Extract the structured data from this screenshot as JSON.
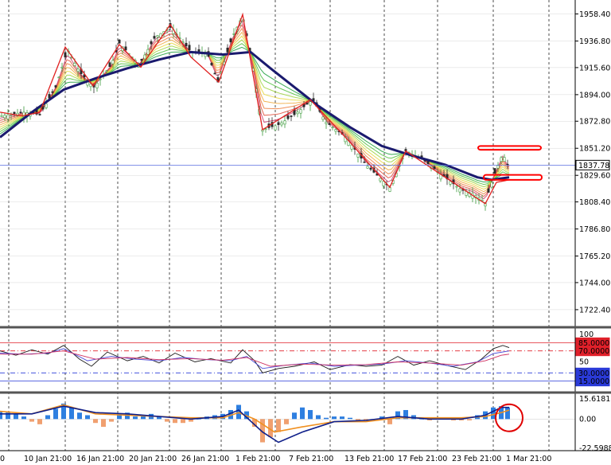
{
  "chart_data": [
    {
      "type": "candlestick",
      "title": "",
      "price_axis": {
        "ticks": [
          1958.4,
          1936.8,
          1915.6,
          1894.0,
          1872.8,
          1851.2,
          1829.6,
          1808.4,
          1786.8,
          1765.2,
          1744.0,
          1722.4
        ],
        "tick_labels": [
          "1958.40",
          "1936.80",
          "1915.60",
          "1894.00",
          "1872.80",
          "1851.20",
          "1829.60",
          "1808.40",
          "1786.80",
          "1765.20",
          "1744.00",
          "1722.40"
        ],
        "ylim": [
          1709,
          1967
        ]
      },
      "time_axis": {
        "labels": [
          "0",
          "10 Jan 21:00",
          "16 Jan 21:00",
          "20 Jan 21:00",
          "26 Jan 21:00",
          "1 Feb 21:00",
          "7 Feb 21:00",
          "13 Feb 21:00",
          "17 Feb 21:00",
          "23 Feb 21:00",
          "1 Mar 21:00"
        ]
      },
      "current_price": "1837.78",
      "current_price_value": 1837.78,
      "close_series": [
        {
          "t": 0,
          "v": 1877
        },
        {
          "t": 30,
          "v": 1880
        },
        {
          "t": 50,
          "v": 1878
        },
        {
          "t": 70,
          "v": 1900
        },
        {
          "t": 85,
          "v": 1930
        },
        {
          "t": 100,
          "v": 1912
        },
        {
          "t": 118,
          "v": 1900
        },
        {
          "t": 140,
          "v": 1918
        },
        {
          "t": 150,
          "v": 1935
        },
        {
          "t": 175,
          "v": 1918
        },
        {
          "t": 195,
          "v": 1940
        },
        {
          "t": 215,
          "v": 1948
        },
        {
          "t": 240,
          "v": 1928
        },
        {
          "t": 260,
          "v": 1928
        },
        {
          "t": 274,
          "v": 1904
        },
        {
          "t": 292,
          "v": 1940
        },
        {
          "t": 305,
          "v": 1957
        },
        {
          "t": 318,
          "v": 1915
        },
        {
          "t": 330,
          "v": 1866
        },
        {
          "t": 350,
          "v": 1870
        },
        {
          "t": 370,
          "v": 1878
        },
        {
          "t": 393,
          "v": 1890
        },
        {
          "t": 410,
          "v": 1872
        },
        {
          "t": 435,
          "v": 1860
        },
        {
          "t": 460,
          "v": 1838
        },
        {
          "t": 490,
          "v": 1820
        },
        {
          "t": 510,
          "v": 1849
        },
        {
          "t": 530,
          "v": 1843
        },
        {
          "t": 555,
          "v": 1830
        },
        {
          "t": 580,
          "v": 1818
        },
        {
          "t": 595,
          "v": 1815
        },
        {
          "t": 610,
          "v": 1808
        },
        {
          "t": 620,
          "v": 1828
        },
        {
          "t": 632,
          "v": 1847
        },
        {
          "t": 638,
          "v": 1838
        }
      ],
      "ma_bold": [
        {
          "t": 0,
          "v": 1860
        },
        {
          "t": 40,
          "v": 1880
        },
        {
          "t": 80,
          "v": 1898
        },
        {
          "t": 120,
          "v": 1907
        },
        {
          "t": 160,
          "v": 1915
        },
        {
          "t": 200,
          "v": 1922
        },
        {
          "t": 240,
          "v": 1928
        },
        {
          "t": 280,
          "v": 1926
        },
        {
          "t": 315,
          "v": 1928
        },
        {
          "t": 340,
          "v": 1915
        },
        {
          "t": 370,
          "v": 1900
        },
        {
          "t": 400,
          "v": 1885
        },
        {
          "t": 440,
          "v": 1868
        },
        {
          "t": 480,
          "v": 1853
        },
        {
          "t": 520,
          "v": 1845
        },
        {
          "t": 560,
          "v": 1838
        },
        {
          "t": 600,
          "v": 1828
        },
        {
          "t": 618,
          "v": 1826
        },
        {
          "t": 640,
          "v": 1828
        }
      ],
      "zigzag": [
        {
          "t": 0,
          "v": 1880
        },
        {
          "t": 28,
          "v": 1877
        },
        {
          "t": 50,
          "v": 1880
        },
        {
          "t": 82,
          "v": 1932
        },
        {
          "t": 117,
          "v": 1901
        },
        {
          "t": 150,
          "v": 1934
        },
        {
          "t": 177,
          "v": 1916
        },
        {
          "t": 214,
          "v": 1950
        },
        {
          "t": 240,
          "v": 1924
        },
        {
          "t": 275,
          "v": 1904
        },
        {
          "t": 305,
          "v": 1958
        },
        {
          "t": 330,
          "v": 1866
        },
        {
          "t": 390,
          "v": 1890
        },
        {
          "t": 440,
          "v": 1856
        },
        {
          "t": 490,
          "v": 1820
        },
        {
          "t": 510,
          "v": 1849
        },
        {
          "t": 555,
          "v": 1830
        },
        {
          "t": 610,
          "v": 1807
        },
        {
          "t": 624,
          "v": 1824
        },
        {
          "t": 640,
          "v": 1826
        }
      ],
      "annotations": [
        {
          "kind": "rect",
          "t0": 601,
          "t1": 680,
          "v0": 1850,
          "v1": 1853,
          "color": "#ff0000"
        },
        {
          "kind": "rect",
          "t0": 608,
          "t1": 681,
          "v0": 1826,
          "v1": 1830,
          "color": "#ff0000"
        }
      ],
      "colors": {
        "bull": "#3a9a3a",
        "bear": "#2b2b2b",
        "zigzag": "#e02020",
        "ma_bold": "#1a1a6e",
        "price_line": "#5a6ee0",
        "grid": "#000000"
      }
    },
    {
      "type": "line",
      "title": "",
      "y_ticks": [
        "100",
        "50"
      ],
      "levels": [
        {
          "label": "85.0000",
          "value": 85,
          "color": "#e0202a"
        },
        {
          "label": "70.0000",
          "value": 70,
          "color": "#e0202a"
        },
        {
          "label": "30.0000",
          "value": 30,
          "color": "#2a3ad8"
        },
        {
          "label": "15.0000",
          "value": 15,
          "color": "#2a3ad8"
        }
      ],
      "ylim": [
        0,
        100
      ],
      "series": [
        {
          "color": "#1b1b1b",
          "values": [
            [
              0,
              70
            ],
            [
              20,
              62
            ],
            [
              40,
              72
            ],
            [
              60,
              64
            ],
            [
              80,
              80
            ],
            [
              100,
              55
            ],
            [
              115,
              42
            ],
            [
              135,
              68
            ],
            [
              160,
              52
            ],
            [
              180,
              60
            ],
            [
              200,
              48
            ],
            [
              220,
              66
            ],
            [
              245,
              50
            ],
            [
              265,
              56
            ],
            [
              290,
              48
            ],
            [
              305,
              72
            ],
            [
              320,
              52
            ],
            [
              330,
              30
            ],
            [
              350,
              38
            ],
            [
              370,
              42
            ],
            [
              395,
              50
            ],
            [
              415,
              36
            ],
            [
              440,
              45
            ],
            [
              460,
              42
            ],
            [
              480,
              44
            ],
            [
              500,
              60
            ],
            [
              520,
              44
            ],
            [
              540,
              52
            ],
            [
              560,
              44
            ],
            [
              585,
              36
            ],
            [
              605,
              55
            ],
            [
              620,
              74
            ],
            [
              632,
              80
            ],
            [
              640,
              76
            ]
          ]
        },
        {
          "color": "#4a4ad8",
          "values": [
            [
              0,
              66
            ],
            [
              30,
              64
            ],
            [
              60,
              66
            ],
            [
              80,
              74
            ],
            [
              110,
              52
            ],
            [
              140,
              60
            ],
            [
              170,
              55
            ],
            [
              200,
              52
            ],
            [
              230,
              58
            ],
            [
              260,
              54
            ],
            [
              290,
              52
            ],
            [
              310,
              60
            ],
            [
              330,
              38
            ],
            [
              360,
              44
            ],
            [
              390,
              48
            ],
            [
              420,
              42
            ],
            [
              450,
              44
            ],
            [
              480,
              46
            ],
            [
              510,
              52
            ],
            [
              540,
              48
            ],
            [
              570,
              42
            ],
            [
              600,
              50
            ],
            [
              620,
              65
            ],
            [
              640,
              70
            ]
          ]
        },
        {
          "color": "#d03060",
          "values": [
            [
              0,
              64
            ],
            [
              40,
              64
            ],
            [
              80,
              70
            ],
            [
              120,
              55
            ],
            [
              160,
              58
            ],
            [
              200,
              54
            ],
            [
              240,
              56
            ],
            [
              280,
              53
            ],
            [
              310,
              58
            ],
            [
              340,
              42
            ],
            [
              380,
              46
            ],
            [
              420,
              44
            ],
            [
              460,
              45
            ],
            [
              500,
              50
            ],
            [
              540,
              48
            ],
            [
              580,
              44
            ],
            [
              610,
              52
            ],
            [
              630,
              62
            ],
            [
              640,
              64
            ]
          ]
        }
      ]
    },
    {
      "type": "histogram",
      "title": "",
      "y_ticks": [
        "15.6181",
        "0.00",
        "-22.5988"
      ],
      "ylim": [
        -22.5988,
        15.6181
      ],
      "bars": [
        [
          0,
          6
        ],
        [
          10,
          5
        ],
        [
          20,
          4
        ],
        [
          30,
          2
        ],
        [
          40,
          -2
        ],
        [
          50,
          -4
        ],
        [
          60,
          3
        ],
        [
          70,
          8
        ],
        [
          80,
          12
        ],
        [
          90,
          9
        ],
        [
          100,
          5
        ],
        [
          110,
          3
        ],
        [
          120,
          -3
        ],
        [
          130,
          -6
        ],
        [
          140,
          -2
        ],
        [
          150,
          4
        ],
        [
          160,
          5
        ],
        [
          170,
          2
        ],
        [
          180,
          3
        ],
        [
          190,
          4
        ],
        [
          200,
          2
        ],
        [
          210,
          -2
        ],
        [
          220,
          -3
        ],
        [
          230,
          -3
        ],
        [
          240,
          -2
        ],
        [
          250,
          0
        ],
        [
          260,
          2
        ],
        [
          270,
          3
        ],
        [
          280,
          4
        ],
        [
          290,
          7
        ],
        [
          300,
          11
        ],
        [
          310,
          6
        ],
        [
          320,
          -6
        ],
        [
          330,
          -18
        ],
        [
          340,
          -14
        ],
        [
          350,
          -10
        ],
        [
          360,
          -4
        ],
        [
          370,
          5
        ],
        [
          380,
          9
        ],
        [
          390,
          7
        ],
        [
          400,
          3
        ],
        [
          410,
          1
        ],
        [
          420,
          2
        ],
        [
          430,
          2
        ],
        [
          440,
          1
        ],
        [
          450,
          -1
        ],
        [
          460,
          -1
        ],
        [
          470,
          0
        ],
        [
          480,
          2
        ],
        [
          490,
          -4
        ],
        [
          500,
          6
        ],
        [
          510,
          7
        ],
        [
          520,
          3
        ],
        [
          530,
          0
        ],
        [
          540,
          -1
        ],
        [
          550,
          1
        ],
        [
          560,
          0
        ],
        [
          570,
          -1
        ],
        [
          580,
          -1
        ],
        [
          590,
          -1
        ],
        [
          600,
          3
        ],
        [
          610,
          6
        ],
        [
          620,
          9
        ],
        [
          630,
          10
        ],
        [
          638,
          9
        ]
      ],
      "signal": [
        [
          0,
          6
        ],
        [
          40,
          4
        ],
        [
          80,
          11
        ],
        [
          120,
          4
        ],
        [
          160,
          3
        ],
        [
          200,
          2
        ],
        [
          240,
          1
        ],
        [
          280,
          1
        ],
        [
          300,
          5
        ],
        [
          320,
          0
        ],
        [
          345,
          -10
        ],
        [
          380,
          -6
        ],
        [
          420,
          -2
        ],
        [
          460,
          -2
        ],
        [
          500,
          1
        ],
        [
          540,
          1
        ],
        [
          580,
          1
        ],
        [
          610,
          2
        ],
        [
          630,
          5
        ],
        [
          640,
          7
        ]
      ],
      "macd": [
        [
          0,
          4
        ],
        [
          40,
          4
        ],
        [
          80,
          10
        ],
        [
          120,
          5
        ],
        [
          160,
          4
        ],
        [
          200,
          2
        ],
        [
          240,
          0
        ],
        [
          280,
          2
        ],
        [
          300,
          7
        ],
        [
          330,
          -10
        ],
        [
          350,
          -18
        ],
        [
          380,
          -10
        ],
        [
          420,
          -2
        ],
        [
          460,
          -1
        ],
        [
          500,
          2
        ],
        [
          540,
          0
        ],
        [
          580,
          0
        ],
        [
          610,
          3
        ],
        [
          630,
          9
        ],
        [
          640,
          9
        ]
      ],
      "annotations": [
        {
          "kind": "circle",
          "t": 640,
          "v": 1,
          "color": "#e00000"
        }
      ],
      "colors": {
        "pos": "#2e7fe0",
        "neg": "#f0a070",
        "signal": "#f09020",
        "macd": "#10208a"
      }
    }
  ]
}
